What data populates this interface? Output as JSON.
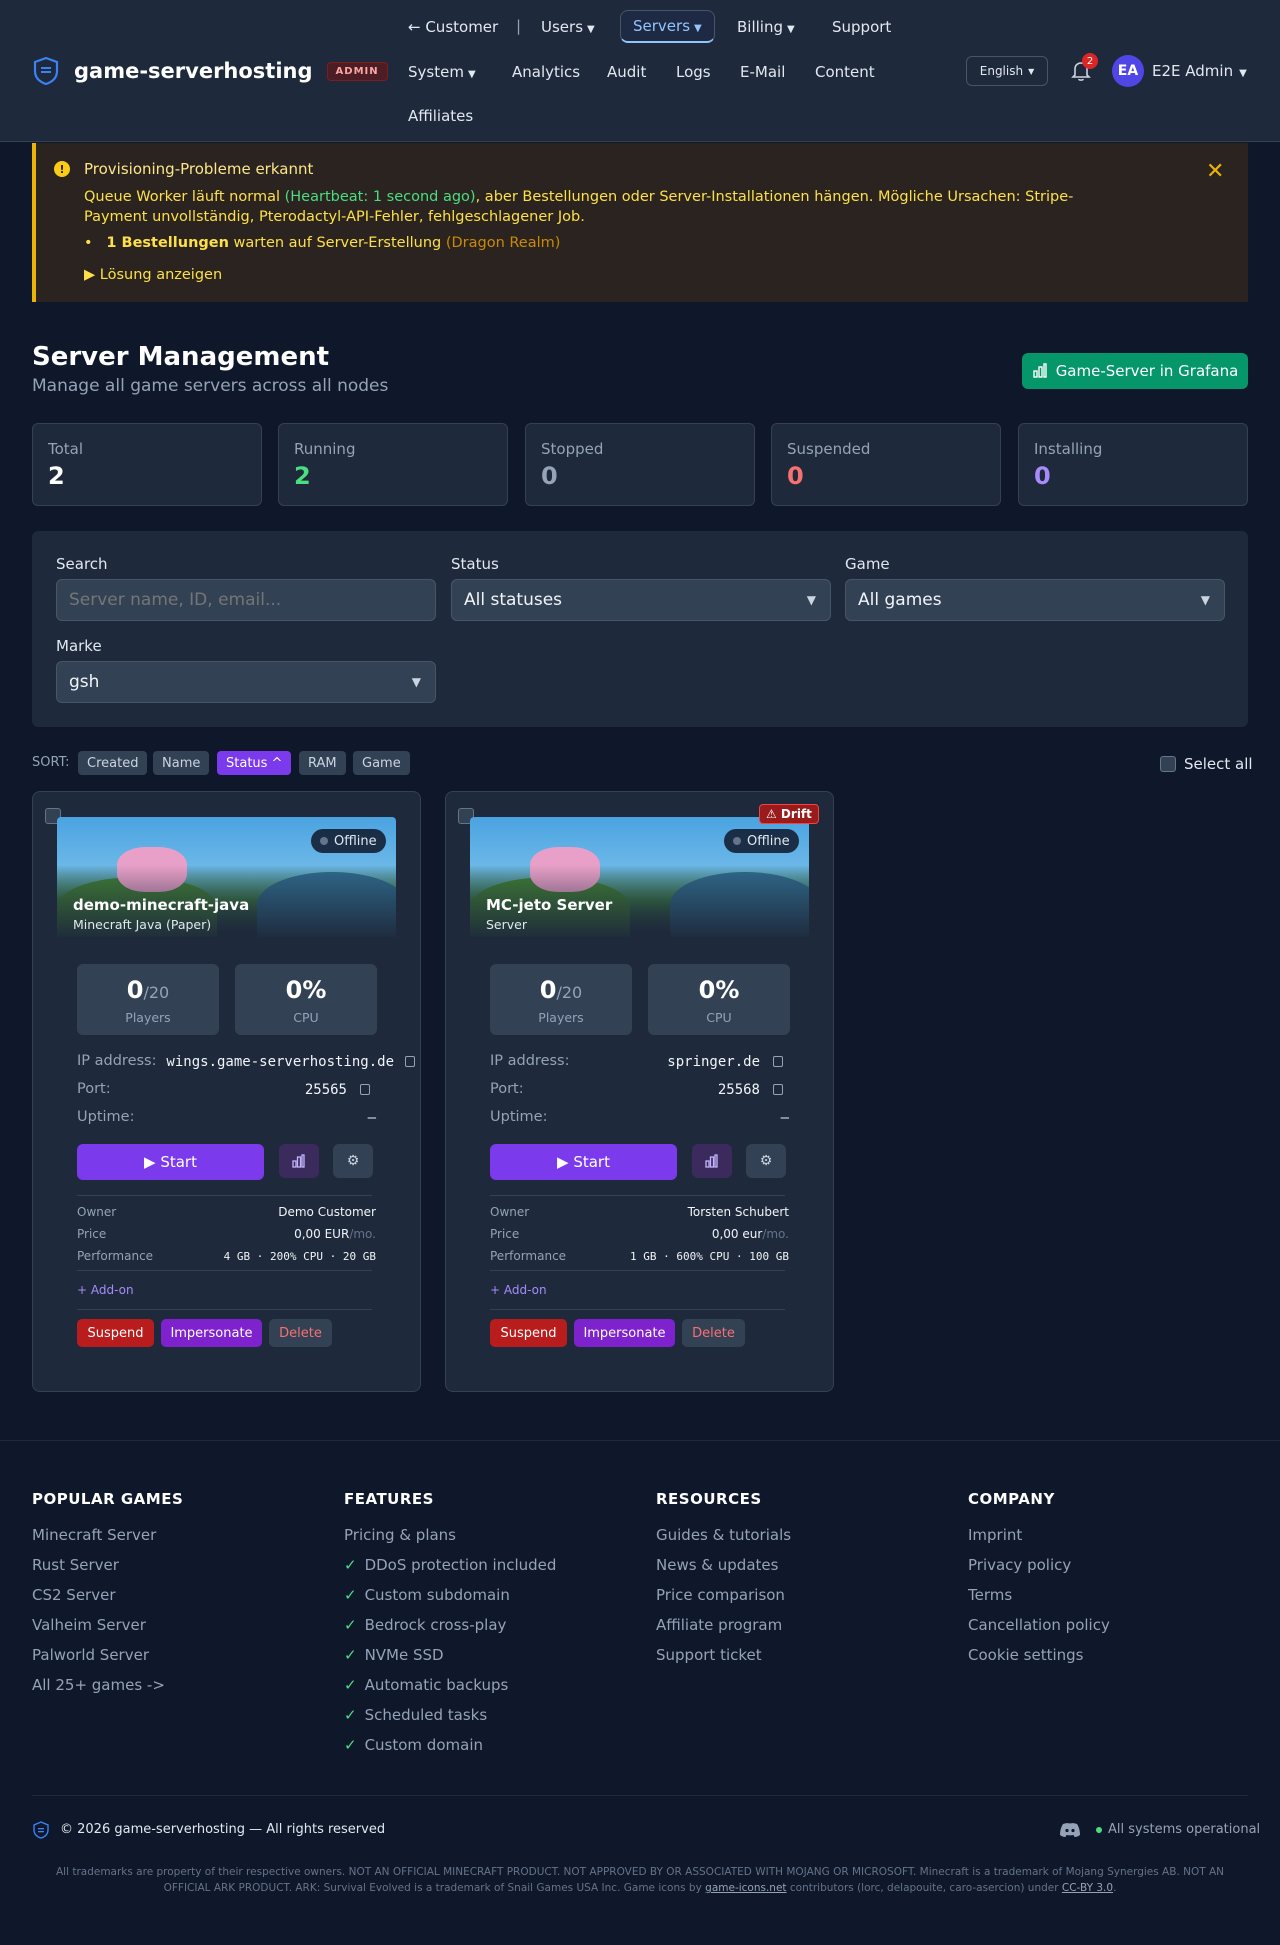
{
  "brand": {
    "name": "game-serverhosting",
    "badge": "ADMIN"
  },
  "nav": {
    "customer": "← Customer",
    "separator": "|",
    "users": "Users",
    "servers": "Servers",
    "billing": "Billing",
    "support": "Support",
    "system": "System",
    "analytics": "Analytics",
    "audit": "Audit",
    "logs": "Logs",
    "email": "E-Mail",
    "content": "Content",
    "affiliates": "Affiliates"
  },
  "header": {
    "language": "English",
    "notifications_count": "2",
    "avatar_initials": "EA",
    "user_name": "E2E Admin"
  },
  "alert": {
    "icon": "!",
    "title": "Provisioning-Probleme erkannt",
    "text_before": "Queue Worker läuft normal ",
    "heartbeat": "(Heartbeat: 1 second ago)",
    "text_after": ", aber Bestellungen oder Server-Installationen hängen. Mögliche Ursachen: Stripe-Payment unvollständig, Pterodactyl-API-Fehler, fehlgeschlagener Job.",
    "bullet_bold": "1 Bestellungen",
    "bullet_text": " warten auf Server-Erstellung ",
    "bullet_muted": "(Dragon Realm)",
    "solution": "▶ Lösung anzeigen",
    "close": "✕"
  },
  "page": {
    "title": "Server Management",
    "subtitle": "Manage all game servers across all nodes",
    "grafana_button": "Game-Server in Grafana"
  },
  "stats": [
    {
      "label": "Total",
      "value": "2",
      "color": "#ffffff"
    },
    {
      "label": "Running",
      "value": "2",
      "color": "#4ade80"
    },
    {
      "label": "Stopped",
      "value": "0",
      "color": "#94a3b8"
    },
    {
      "label": "Suspended",
      "value": "0",
      "color": "#f87171"
    },
    {
      "label": "Installing",
      "value": "0",
      "color": "#a78bfa"
    }
  ],
  "filters": {
    "search_label": "Search",
    "search_placeholder": "Server name, ID, email...",
    "status_label": "Status",
    "status_value": "All statuses",
    "game_label": "Game",
    "game_value": "All games",
    "brand_label": "Marke",
    "brand_value": "gsh"
  },
  "sort": {
    "label": "SORT:",
    "chips": [
      "Created",
      "Name",
      "Status ^",
      "RAM",
      "Game"
    ],
    "active": "Status",
    "select_all": "Select all"
  },
  "servers": [
    {
      "name": "demo-minecraft-java",
      "game": "Minecraft Java (Paper)",
      "status": "Offline",
      "drift": "",
      "players": "0",
      "players_max": "/20",
      "players_label": "Players",
      "cpu": "0%",
      "cpu_label": "CPU",
      "ip_label": "IP address:",
      "ip": "wings.game-serverhosting.de",
      "port_label": "Port:",
      "port": "25565",
      "uptime_label": "Uptime:",
      "uptime": "—",
      "start_label": "▶ Start",
      "owner_label": "Owner",
      "owner": "Demo Customer",
      "price_label": "Price",
      "price": "0,00 EUR",
      "price_unit": "/mo.",
      "performance_label": "Performance",
      "performance": "4 GB · 200% CPU · 20 GB",
      "addon": "+ Add-on",
      "suspend": "Suspend",
      "impersonate": "Impersonate",
      "delete": "Delete"
    },
    {
      "name": "MC-jeto Server",
      "game": "Server",
      "status": "Offline",
      "drift": "⚠ Drift",
      "players": "0",
      "players_max": "/20",
      "players_label": "Players",
      "cpu": "0%",
      "cpu_label": "CPU",
      "ip_label": "IP address:",
      "ip": "springer.de",
      "port_label": "Port:",
      "port": "25568",
      "uptime_label": "Uptime:",
      "uptime": "—",
      "start_label": "▶ Start",
      "owner_label": "Owner",
      "owner": "Torsten Schubert",
      "price_label": "Price",
      "price": "0,00 eur",
      "price_unit": "/mo.",
      "performance_label": "Performance",
      "performance": "1 GB · 600% CPU · 100 GB",
      "addon": "+ Add-on",
      "suspend": "Suspend",
      "impersonate": "Impersonate",
      "delete": "Delete"
    }
  ],
  "footer": {
    "columns": [
      {
        "title": "POPULAR GAMES",
        "links": [
          "Minecraft Server",
          "Rust Server",
          "CS2 Server",
          "Valheim Server",
          "Palworld Server",
          "All 25+ games ->"
        ]
      },
      {
        "title": "FEATURES",
        "links": [
          "Pricing & plans",
          "DDoS protection included",
          "Custom subdomain",
          "Bedrock cross-play",
          "NVMe SSD",
          "Automatic backups",
          "Scheduled tasks",
          "Custom domain"
        ]
      },
      {
        "title": "RESOURCES",
        "links": [
          "Guides & tutorials",
          "News & updates",
          "Price comparison",
          "Affiliate program",
          "Support ticket"
        ]
      },
      {
        "title": "COMPANY",
        "links": [
          "Imprint",
          "Privacy policy",
          "Terms",
          "Cancellation policy",
          "Cookie settings"
        ]
      }
    ],
    "check": "✓",
    "copyright": "© 2026 game-serverhosting — All rights reserved",
    "status": "All systems operational",
    "disclaimer_1": "All trademarks are property of their respective owners. NOT AN OFFICIAL MINECRAFT PRODUCT. NOT APPROVED BY OR ASSOCIATED WITH MOJANG OR MICROSOFT. Minecraft is a trademark of Mojang Synergies AB. NOT AN OFFICIAL ARK PRODUCT. ARK: Survival Evolved is a trademark of Snail Games USA Inc. Game icons by ",
    "disclaimer_link1": "game-icons.net",
    "disclaimer_2": " contributors (lorc, delapouite, caro-asercion) under ",
    "disclaimer_link2": "CC-BY 3.0",
    "disclaimer_3": "."
  },
  "colors": {
    "accent": "#7c3aed",
    "success": "#059669",
    "danger": "#b91c1c",
    "warning": "#eab308"
  }
}
